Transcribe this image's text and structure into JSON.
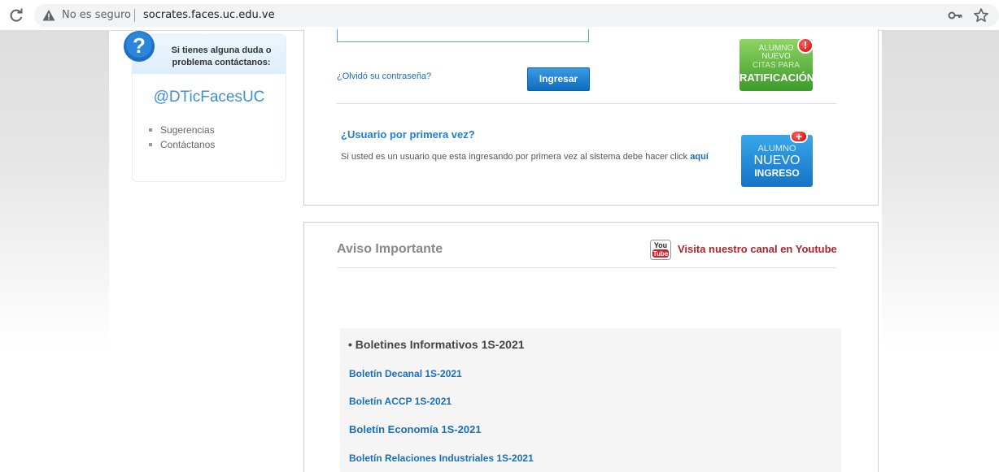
{
  "browser": {
    "security_label": "No es seguro",
    "url": "socrates.faces.uc.edu.ve"
  },
  "help": {
    "text": "Si tienes alguna duda o problema contáctanos:",
    "handle": "@DTicFacesUC",
    "links": [
      "Sugerencias",
      "Contáctanos"
    ]
  },
  "login": {
    "forgot_link": "¿Olvidó su contraseña?",
    "submit_label": "Ingresar",
    "first_time_title": "¿Usuario por primera vez?",
    "first_time_desc": "Si usted es un usuario que esta ingresando por primera vez al sistema debe hacer click ",
    "first_time_link": "aquí"
  },
  "badges": {
    "ratificacion": {
      "line1": "ALUMNO",
      "line2": "NUEVO",
      "line3": "CITAS PARA",
      "line4": "RATIFICACIÓN",
      "mark": "!"
    },
    "nuevo_ingreso": {
      "line1": "ALUMNO",
      "line2": "NUEVO",
      "line3": "INGRESO",
      "mark": "+"
    }
  },
  "aviso": {
    "title": "Aviso Importante",
    "youtube_link": "Visita nuestro canal en Youtube",
    "youtube_icon_text": {
      "top": "You",
      "bottom": "Tube"
    },
    "bulletins_heading": "• Boletines Informativos 1S-2021",
    "bulletins": [
      "Boletín Decanal 1S-2021",
      "Boletín ACCP 1S-2021",
      "Boletín Economía 1S-2021",
      "Boletín Relaciones Industriales 1S-2021"
    ]
  },
  "colors": {
    "accent_blue": "#1b6fb9",
    "youtube_red": "#b3242a",
    "green_badge": "#3c9a2a",
    "blue_badge": "#1573c7"
  }
}
